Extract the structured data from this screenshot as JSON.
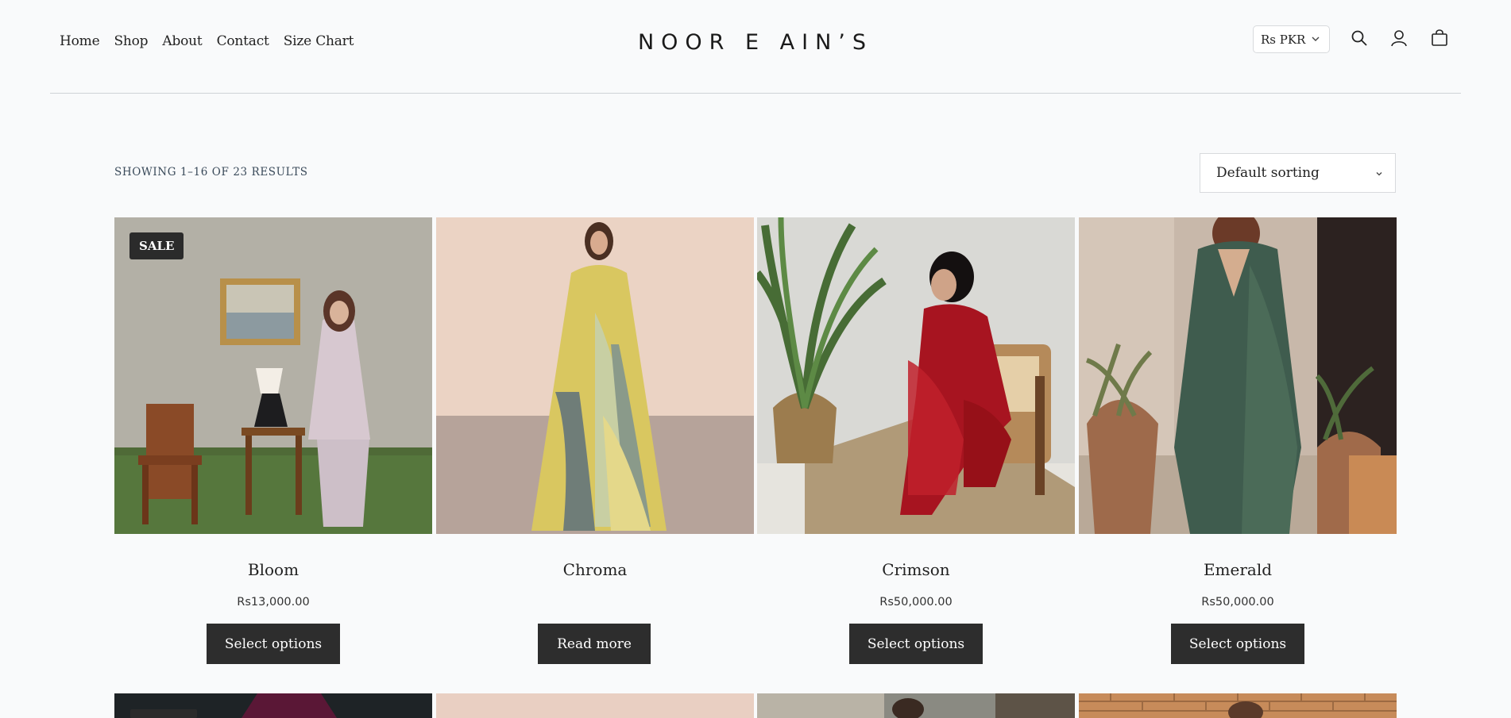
{
  "header": {
    "nav": [
      "Home",
      "Shop",
      "About",
      "Contact",
      "Size Chart"
    ],
    "logo": "NOOR E AIN’S",
    "currency": "Rs PKR"
  },
  "shop": {
    "results_text": "SHOWING 1–16 OF 23 RESULTS",
    "sort_value": "Default sorting"
  },
  "products": [
    {
      "name": "Bloom",
      "price": "Rs13,000.00",
      "button": "Select options",
      "badge": "SALE"
    },
    {
      "name": "Chroma",
      "price": "",
      "button": "Read more",
      "badge": ""
    },
    {
      "name": "Crimson",
      "price": "Rs50,000.00",
      "button": "Select options",
      "badge": ""
    },
    {
      "name": "Emerald",
      "price": "Rs50,000.00",
      "button": "Select options",
      "badge": ""
    }
  ],
  "icons": [
    "search-icon",
    "account-icon",
    "cart-icon",
    "chevron-down-icon"
  ],
  "colors": {
    "button_bg": "#2d2d2d",
    "page_bg": "#f9fafb",
    "badge_bg": "#2b2b2b"
  }
}
